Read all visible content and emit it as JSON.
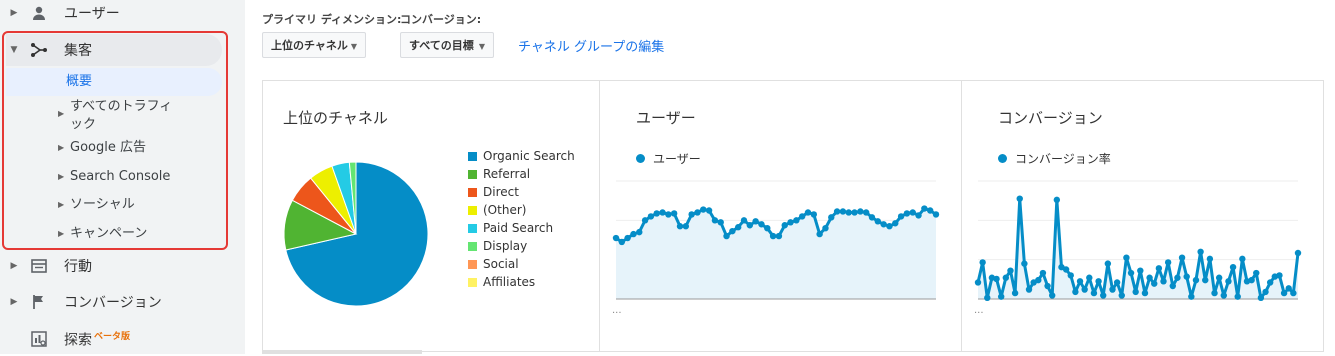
{
  "sidebar": {
    "items": [
      {
        "label": "ユーザー"
      },
      {
        "label": "集客"
      },
      {
        "label": "行動"
      },
      {
        "label": "コンバージョン"
      },
      {
        "label": "探索",
        "badge": "ベータ版"
      }
    ],
    "acquisition_sub": [
      {
        "label": "概要"
      },
      {
        "label_line1": "すべてのトラフィ",
        "label_line2": "ック"
      },
      {
        "label": "Google 広告"
      },
      {
        "label": "Search Console"
      },
      {
        "label": "ソーシャル"
      },
      {
        "label": "キャンペーン"
      }
    ]
  },
  "controls": {
    "primary_dimension_label": "プライマリ ディメンション:",
    "conversion_label": "コンバージョン:",
    "primary_dimension_value": "上位のチャネル",
    "conversion_value": "すべての目標",
    "edit_link": "チャネル グループの編集"
  },
  "colors": {
    "accent_blue": "#058dc7",
    "link_blue": "#1a73e8",
    "highlight_red": "#e53935"
  },
  "cards": {
    "channels_title": "上位のチャネル",
    "users_title": "ユーザー",
    "users_series": "ユーザー",
    "conversions_title": "コンバージョン",
    "conversions_series": "コンバージョン率",
    "ellipsis": "..."
  },
  "chart_data": [
    {
      "type": "pie",
      "title": "上位のチャネル",
      "categories": [
        "Organic Search",
        "Referral",
        "Direct",
        "(Other)",
        "Paid Search",
        "Display",
        "Social",
        "Affiliates"
      ],
      "values": [
        72.5,
        11.5,
        6.5,
        5.5,
        4.0,
        1.5,
        0,
        0
      ],
      "colors": [
        "#058dc7",
        "#50b432",
        "#ed561b",
        "#edef00",
        "#24cbe5",
        "#64e572",
        "#ff9655",
        "#fff263"
      ],
      "legend_position": "right"
    },
    {
      "type": "area",
      "title": "ユーザー",
      "series": [
        {
          "name": "ユーザー",
          "values": [
            62,
            58,
            62,
            66,
            68,
            80,
            84,
            87,
            88,
            86,
            87,
            74,
            74,
            86,
            88,
            91,
            90,
            80,
            78,
            64,
            69,
            73,
            80,
            75,
            79,
            76,
            72,
            64,
            64,
            75,
            78,
            80,
            84,
            88,
            86,
            66,
            72,
            83,
            89,
            89,
            88,
            88,
            89,
            88,
            83,
            79,
            76,
            74,
            77,
            84,
            87,
            88,
            85,
            92,
            90,
            86
          ]
        }
      ],
      "ylim": [
        0,
        120
      ],
      "grid": true
    },
    {
      "type": "line",
      "title": "コンバージョン",
      "series": [
        {
          "name": "コンバージョン率",
          "values": [
            14,
            31,
            1,
            18,
            17,
            2,
            18,
            24,
            5,
            85,
            30,
            8,
            14,
            16,
            22,
            11,
            3,
            84,
            27,
            25,
            20,
            6,
            15,
            8,
            18,
            5,
            15,
            3,
            30,
            8,
            14,
            3,
            35,
            22,
            6,
            24,
            5,
            18,
            13,
            26,
            15,
            31,
            11,
            18,
            35,
            19,
            2,
            16,
            40,
            16,
            34,
            5,
            18,
            3,
            15,
            27,
            2,
            34,
            15,
            16,
            22,
            1,
            6,
            14,
            19,
            20,
            5,
            9,
            5,
            39
          ]
        }
      ],
      "ylim": [
        0,
        100
      ],
      "grid": true
    }
  ]
}
